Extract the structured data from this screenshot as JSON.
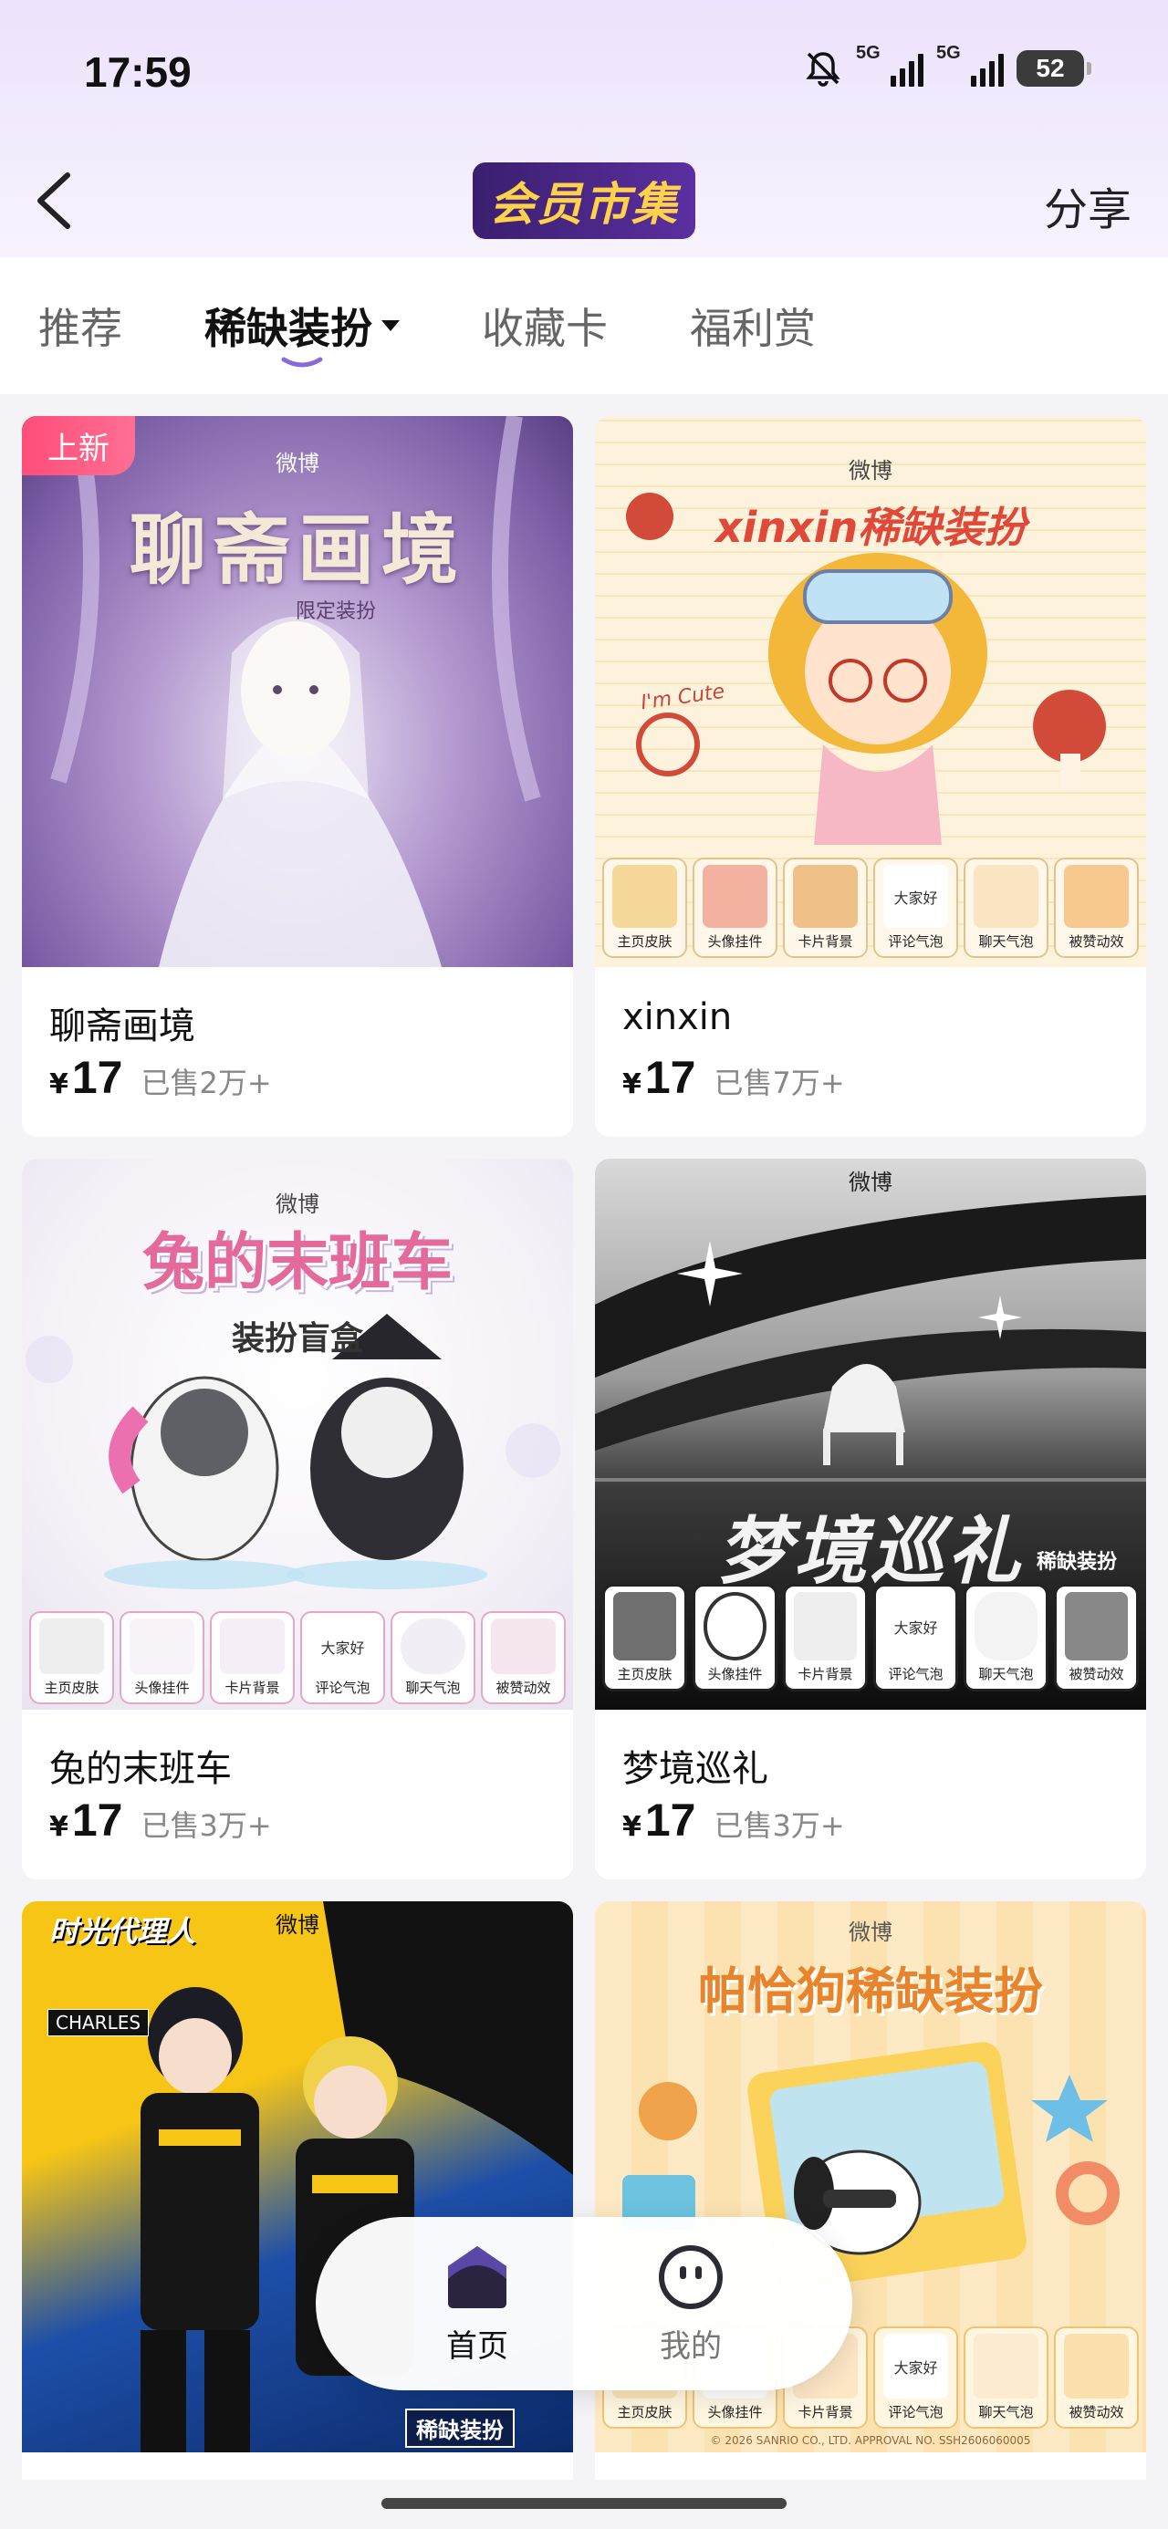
{
  "status_bar": {
    "time": "17:59",
    "signal1_label": "5G",
    "signal2_label": "5G",
    "battery": "52",
    "icons": [
      "mute-bell-icon",
      "signal-icon",
      "signal-icon",
      "battery-icon"
    ]
  },
  "header": {
    "title": "会员市集",
    "share_label": "分享",
    "back_icon": "chevron-left-icon"
  },
  "tabs": [
    {
      "label": "推荐",
      "active": false
    },
    {
      "label": "稀缺装扮",
      "active": true
    },
    {
      "label": "收藏卡",
      "active": false
    },
    {
      "label": "福利赏",
      "active": false
    }
  ],
  "cards": [
    {
      "badge": "上新",
      "weibo": "微博",
      "image_title": "聊斋画境",
      "image_subtitle": "限定装扮",
      "name": "聊斋画境",
      "currency": "¥",
      "price": "17",
      "sold": "已售2万+"
    },
    {
      "weibo": "微博",
      "image_title": "xinxin稀缺装扮",
      "image_note": "I'm Cute",
      "items": [
        "主页皮肤",
        "头像挂件",
        "卡片背景",
        "评论气泡",
        "聊天气泡",
        "被赞动效"
      ],
      "bubble_text": "大家好",
      "name": "xinxin",
      "currency": "¥",
      "price": "17",
      "sold": "已售7万+"
    },
    {
      "weibo": "微博",
      "image_title": "兔的末班车",
      "image_subtitle": "装扮盲盒",
      "items": [
        "主页皮肤",
        "头像挂件",
        "卡片背景",
        "评论气泡",
        "聊天气泡",
        "被赞动效"
      ],
      "bubble_text": "大家好",
      "name": "兔的末班车",
      "currency": "¥",
      "price": "17",
      "sold": "已售3万+"
    },
    {
      "weibo": "微博",
      "image_title": "梦境巡礼",
      "image_subtitle": "稀缺装扮",
      "items": [
        "主页皮肤",
        "头像挂件",
        "卡片背景",
        "评论气泡",
        "聊天气泡",
        "被赞动效"
      ],
      "bubble_text": "大家好",
      "name": "梦境巡礼",
      "currency": "¥",
      "price": "17",
      "sold": "已售3万+"
    },
    {
      "weibo": "微博",
      "image_title": "时光代理人",
      "image_subtitle": "稀缺装扮",
      "charles": "CHARLES",
      "name": "",
      "price": "",
      "sold": ""
    },
    {
      "weibo": "微博",
      "image_title": "帕恰狗稀缺装扮",
      "items": [
        "主页皮肤",
        "头像挂件",
        "卡片背景",
        "评论气泡",
        "聊天气泡",
        "被赞动效"
      ],
      "bubble_text": "大家好",
      "copyright": "© 2026 SANRIO CO., LTD.  APPROVAL NO. SSH2606060005",
      "name": "",
      "price": "",
      "sold": ""
    }
  ],
  "bottom_nav": [
    {
      "label": "首页",
      "icon": "home-icon",
      "active": true
    },
    {
      "label": "我的",
      "icon": "profile-face-icon",
      "active": false
    }
  ],
  "colors": {
    "accent_purple": "#8b6ad8",
    "badge_pink": "#ff4d7a",
    "header_bg": "#ece2fb"
  }
}
